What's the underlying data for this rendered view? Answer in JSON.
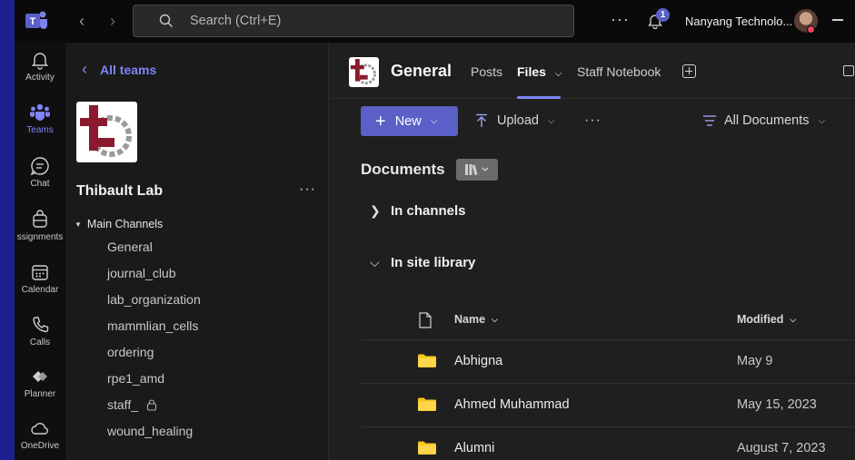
{
  "titlebar": {
    "search_placeholder": "Search (Ctrl+E)",
    "notification_count": "1",
    "org_name": "Nanyang Technolo..."
  },
  "rail": {
    "items": [
      {
        "label": "Activity",
        "icon": "bell-icon"
      },
      {
        "label": "Teams",
        "icon": "teams-icon",
        "active": true
      },
      {
        "label": "Chat",
        "icon": "chat-icon"
      },
      {
        "label": "ssignments",
        "icon": "assignments-icon"
      },
      {
        "label": "Calendar",
        "icon": "calendar-icon"
      },
      {
        "label": "Calls",
        "icon": "phone-icon"
      },
      {
        "label": "Planner",
        "icon": "planner-icon"
      },
      {
        "label": "OneDrive",
        "icon": "cloud-icon"
      }
    ]
  },
  "team_pane": {
    "back_label": "All teams",
    "team_name": "Thibault Lab",
    "group_label": "Main Channels",
    "channels": [
      "General",
      "journal_club",
      "lab_organization",
      "mammlian_cells",
      "ordering",
      "rpe1_amd",
      "staff_",
      "wound_healing"
    ]
  },
  "main": {
    "channel_title": "General",
    "tabs": [
      "Posts",
      "Files",
      "Staff Notebook"
    ],
    "active_tab": "Files",
    "toolbar": {
      "new_label": "New",
      "upload_label": "Upload",
      "view_label": "All Documents"
    },
    "docs_title": "Documents",
    "sections": [
      "In channels",
      "In site library"
    ],
    "columns": {
      "name": "Name",
      "modified": "Modified"
    },
    "files": [
      {
        "name": "Abhigna",
        "modified": "May 9"
      },
      {
        "name": "Ahmed Muhammad",
        "modified": "May 15, 2023"
      },
      {
        "name": "Alumni",
        "modified": "August 7, 2023"
      }
    ]
  },
  "colors": {
    "accent": "#5b5fc7",
    "accent_light": "#7f85f5",
    "folder": "#f5c518",
    "background": "#1f1f1f",
    "frame": "#1e1f8f"
  }
}
